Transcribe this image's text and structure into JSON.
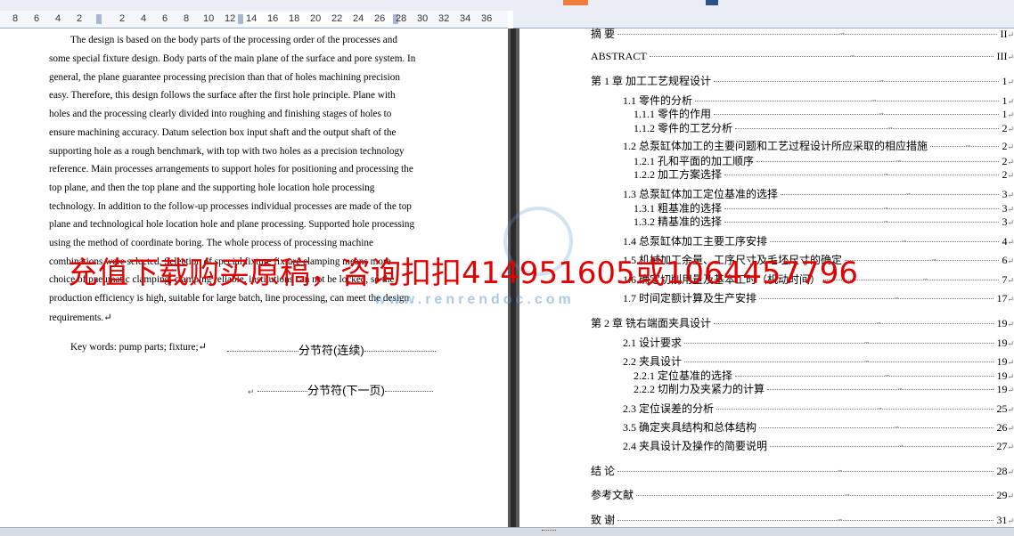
{
  "ruler": {
    "numbers": [
      "8",
      "6",
      "4",
      "2",
      "2",
      "4",
      "6",
      "8",
      "10",
      "12",
      "14",
      "16",
      "18",
      "20",
      "22",
      "24",
      "26",
      "28",
      "30",
      "32",
      "34",
      "36"
    ]
  },
  "abstract_lines": [
    "The design is based on the body parts of the processing order of the processes and",
    "some special fixture design. Body parts of the main plane of the surface and pore system. In",
    "general, the plane guarantee processing precision than that of holes machining precision",
    "easy. Therefore, this design follows the surface after the first hole principle. Plane with",
    "holes and the processing clearly divided into roughing and finishing stages of holes to",
    "ensure machining accuracy. Datum selection box input shaft and the output shaft of the",
    "supporting hole as a rough benchmark, with top with two holes as a precision technology",
    "reference. Main processes arrangements to support holes for positioning and processing the",
    "top plane, and then the top plane and the supporting hole location hole processing",
    "technology. In addition to the follow-up processes individual processes are made of the top",
    "plane and technological hole location hole and plane processing. Supported hole processing",
    "using the method of coordinate boring. The whole process of processing machine",
    "combinations were selected. Selection of special fixture fixture clamping means more",
    "choice of pneumatic clamping, clamping reliable, institutions can not be locked, so the",
    "production efficiency is high, suitable for large batch, line processing, can meet the design",
    "requirements.↵"
  ],
  "keywords": "Key words: pump    parts; fixture;↵",
  "section_break_continuous": "分节符(连续)",
  "section_break_next_page": "分节符(下一页)",
  "toc": [
    {
      "title": "摘    要",
      "page": "II"
    },
    {
      "title": "ABSTRACT",
      "page": "III"
    },
    {
      "title": "第 1 章  加工工艺规程设计",
      "page": "1"
    },
    {
      "title": "1.1  零件的分析",
      "page": "1"
    },
    {
      "title": "1.1.1  零件的作用",
      "page": "1"
    },
    {
      "title": "1.1.2  零件的工艺分析",
      "page": "2"
    },
    {
      "title": "1.2  总泵缸体加工的主要问题和工艺过程设计所应采取的相应措施",
      "page": "2"
    },
    {
      "title": "1.2.1  孔和平面的加工顺序",
      "page": "2"
    },
    {
      "title": "1.2.2 加工方案选择",
      "page": "2"
    },
    {
      "title": "1.3  总泵缸体加工定位基准的选择",
      "page": "3"
    },
    {
      "title": "1.3.1  粗基准的选择",
      "page": "3"
    },
    {
      "title": "1.3.2  精基准的选择",
      "page": "3"
    },
    {
      "title": "1.4  总泵缸体加工主要工序安排",
      "page": "4"
    },
    {
      "title": "1.5  机械加工余量、工序尺寸及毛坯尺寸的确定",
      "page": "6"
    },
    {
      "title": "1.6 确定切削用量及基本工时（机动时间）",
      "page": "7"
    },
    {
      "title": "1.7  时间定额计算及生产安排",
      "page": "17"
    },
    {
      "title": "第 2 章  铣右端面夹具设计",
      "page": "19"
    },
    {
      "title": "2.1 设计要求",
      "page": "19"
    },
    {
      "title": "2.2 夹具设计",
      "page": "19"
    },
    {
      "title": "2.2.1    定位基准的选择",
      "page": "19"
    },
    {
      "title": "2.2.2    切削力及夹紧力的计算",
      "page": "19"
    },
    {
      "title": "2.3 定位误差的分析",
      "page": "25"
    },
    {
      "title": "3.5  确定夹具结构和总体结构",
      "page": "26"
    },
    {
      "title": "2.4 夹具设计及操作的简要说明",
      "page": "27"
    },
    {
      "title": "结  论",
      "page": "28"
    },
    {
      "title": "参考文献",
      "page": "29"
    },
    {
      "title": "致  谢",
      "page": "31"
    }
  ],
  "watermark": {
    "url": "www.renrendoc.com",
    "promo": "充值下载购买原稿，咨询扣扣414951605或1064457796"
  },
  "colors": {
    "promo_red": "#e30000",
    "watermark_blue": "#5a96c8",
    "divider": "#2b2b2b"
  }
}
